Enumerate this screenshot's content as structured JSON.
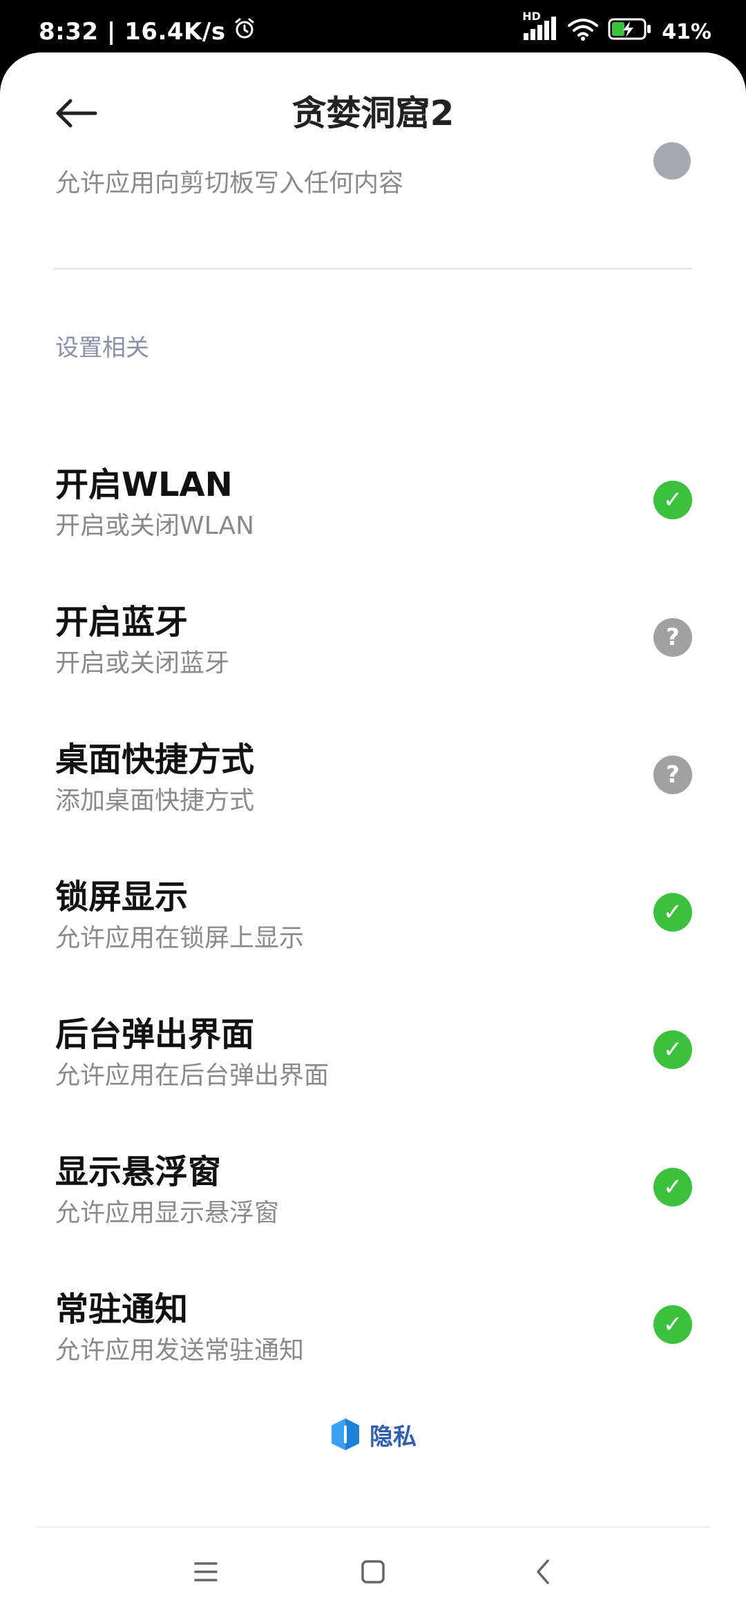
{
  "status_bar": {
    "time_speed": "8:32 | 16.4K/s",
    "network_label": "HD",
    "battery_percent": "41%",
    "battery_level": 0.41
  },
  "header": {
    "back_icon": "arrow-left-icon",
    "title": "贪婪洞窟2"
  },
  "partial_item": {
    "subtitle": "允许应用向剪切板写入任何内容"
  },
  "section": {
    "title": "设置相关"
  },
  "permissions": [
    {
      "title": "开启WLAN",
      "subtitle": "开启或关闭WLAN",
      "status": "allowed",
      "status_glyph": "✓"
    },
    {
      "title": "开启蓝牙",
      "subtitle": "开启或关闭蓝牙",
      "status": "ask",
      "status_glyph": "?"
    },
    {
      "title": "桌面快捷方式",
      "subtitle": "添加桌面快捷方式",
      "status": "ask",
      "status_glyph": "?"
    },
    {
      "title": "锁屏显示",
      "subtitle": "允许应用在锁屏上显示",
      "status": "allowed",
      "status_glyph": "✓"
    },
    {
      "title": "后台弹出界面",
      "subtitle": "允许应用在后台弹出界面",
      "status": "allowed",
      "status_glyph": "✓"
    },
    {
      "title": "显示悬浮窗",
      "subtitle": "允许应用显示悬浮窗",
      "status": "allowed",
      "status_glyph": "✓"
    },
    {
      "title": "常驻通知",
      "subtitle": "允许应用发送常驻通知",
      "status": "allowed",
      "status_glyph": "✓"
    }
  ],
  "footer": {
    "privacy_label": "隐私",
    "privacy_icon": "shield-icon"
  },
  "nav": {
    "menu_icon": "menu-icon",
    "home_icon": "home-square-icon",
    "back_icon": "chevron-left-icon"
  },
  "colors": {
    "allowed": "#3bc13e",
    "ask": "#a1a1a1",
    "section_title": "#8a90a8",
    "brand_blue": "#2f5fb0"
  }
}
